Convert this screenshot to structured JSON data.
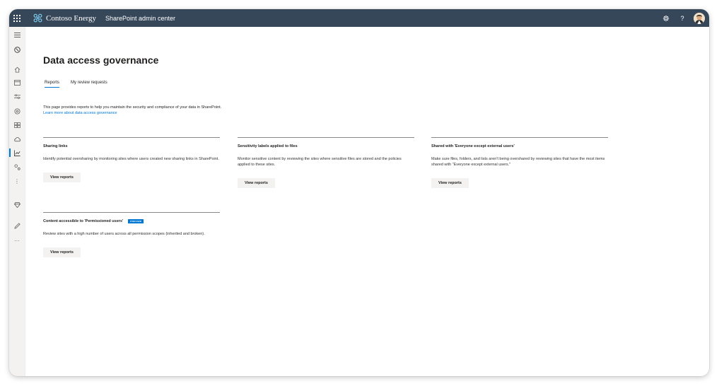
{
  "topbar": {
    "org_name": "Contoso Energy",
    "app_name": "SharePoint admin center",
    "settings_icon": "gear-icon",
    "help_label": "?"
  },
  "rail": {
    "icons": [
      "hamburger-icon",
      "globe-icon",
      "home-icon",
      "sites-icon",
      "policies-icon",
      "settings-icon",
      "content-services-icon",
      "migration-icon",
      "reports-icon",
      "advanced-management-icon",
      "more-icon",
      "diamond-icon",
      "edit-icon",
      "ellipsis-icon"
    ],
    "more_label": "⋮",
    "ellipsis_label": "···"
  },
  "main": {
    "title": "Data access governance",
    "tabs": [
      {
        "label": "Reports",
        "active": true
      },
      {
        "label": "My review requests",
        "active": false
      }
    ],
    "description": "This page provides reports to help you maintain the security and compliance of your data in SharePoint.",
    "learn_more": "Learn more about data access governance",
    "cards": [
      {
        "title": "Sharing links",
        "description": "Identify potential oversharing by monitoring sites where users created new sharing links in SharePoint.",
        "button": "View reports"
      },
      {
        "title": "Sensitivity labels applied to files",
        "description": "Monitor sensitive content by reviewing the sites where sensitive files are stored and the policies applied to these sites.",
        "button": "View reports"
      },
      {
        "title": "Shared with 'Everyone except external users'",
        "description": "Make sure files, folders, and lists aren't being overshared by reviewing sites that have the most items shared with \"Everyone except external users.\"",
        "button": "View reports"
      },
      {
        "title": "Content accessible to 'Permissioned users'",
        "badge": "PREVIEW",
        "description": "Review sites with a high number of users across all permission scopes (inherited and broken).",
        "button": "View reports"
      }
    ]
  },
  "colors": {
    "topbar_bg": "#37475a",
    "accent": "#0078d4",
    "button_bg": "#f3f2f1"
  }
}
